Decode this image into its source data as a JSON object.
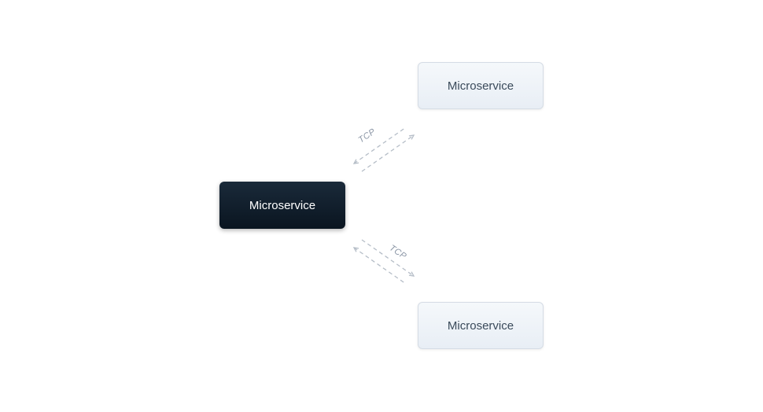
{
  "diagram": {
    "nodes": {
      "central": {
        "label": "Microservice"
      },
      "topRight": {
        "label": "Microservice"
      },
      "bottomRight": {
        "label": "Microservice"
      }
    },
    "connectors": {
      "top": {
        "label": "TCP"
      },
      "bottom": {
        "label": "TCP"
      }
    },
    "colors": {
      "darkNodeGradientStart": "#1a2a3a",
      "darkNodeGradientEnd": "#0a1520",
      "lightNodeGradientStart": "#f5f8fb",
      "lightNodeGradientEnd": "#e8eef5",
      "lightNodeBorder": "#d5dce5",
      "lightNodeText": "#3a4a5a",
      "connectorStroke": "#b5bdc7",
      "labelColor": "#8a95a5"
    }
  }
}
